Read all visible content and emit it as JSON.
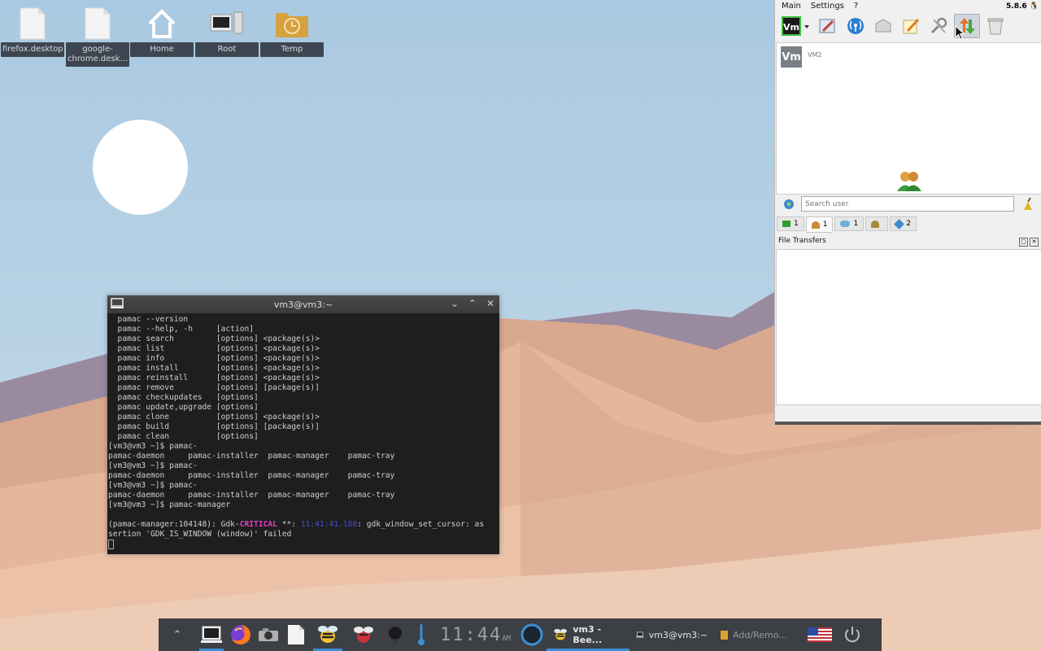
{
  "desktop": {
    "icons": [
      {
        "label": "firefox.desktop"
      },
      {
        "label": "google-chrome.desk..."
      },
      {
        "label": "Home"
      },
      {
        "label": "Root"
      },
      {
        "label": "Temp"
      }
    ]
  },
  "terminal": {
    "title": "vm3@vm3:~",
    "lines": [
      "  pamac --version",
      "  pamac --help, -h     [action]",
      "  pamac search         [options] <package(s)>",
      "  pamac list           [options] <package(s)>",
      "  pamac info           [options] <package(s)>",
      "  pamac install        [options] <package(s)>",
      "  pamac reinstall      [options] <package(s)>",
      "  pamac remove         [options] [package(s)]",
      "  pamac checkupdates   [options]",
      "  pamac update,upgrade [options]",
      "  pamac clone          [options] <package(s)>",
      "  pamac build          [options] [package(s)]",
      "  pamac clean          [options]",
      "[vm3@vm3 ~]$ pamac-",
      "pamac-daemon     pamac-installer  pamac-manager    pamac-tray",
      "[vm3@vm3 ~]$ pamac-",
      "pamac-daemon     pamac-installer  pamac-manager    pamac-tray",
      "[vm3@vm3 ~]$ pamac-",
      "pamac-daemon     pamac-installer  pamac-manager    pamac-tray",
      "[vm3@vm3 ~]$ pamac-manager",
      ""
    ],
    "err_prefix": "(pamac-manager:104148): Gdk-",
    "err_level": "CRITICAL",
    "err_mid": " **: ",
    "err_time": "11:41:41.180",
    "err_rest": ": gdk_window_set_cursor: as",
    "err_line2": "sertion 'GDK_IS_WINDOW (window)' failed"
  },
  "beebeep": {
    "menu": [
      "Main",
      "Settings",
      "?"
    ],
    "version": "5.8.6",
    "user_tile": "Vm",
    "user_name": "VM2",
    "search_placeholder": "Search user",
    "tabs": [
      {
        "icon": "chat-icon",
        "count": "1"
      },
      {
        "icon": "users-icon",
        "count": "1"
      },
      {
        "icon": "group-icon",
        "count": "1"
      },
      {
        "icon": "network-icon",
        "count": ""
      },
      {
        "icon": "share-icon",
        "count": "2"
      }
    ],
    "file_transfers_title": "File Transfers",
    "colors": {
      "active_tool": "#cfd5dc"
    }
  },
  "taskbar": {
    "clock": "11:44",
    "ampm": "AM",
    "tasks": [
      {
        "label": "vm3 - Bee..."
      },
      {
        "label": "vm3@vm3:~"
      },
      {
        "label": "Add/Remo..."
      }
    ]
  }
}
